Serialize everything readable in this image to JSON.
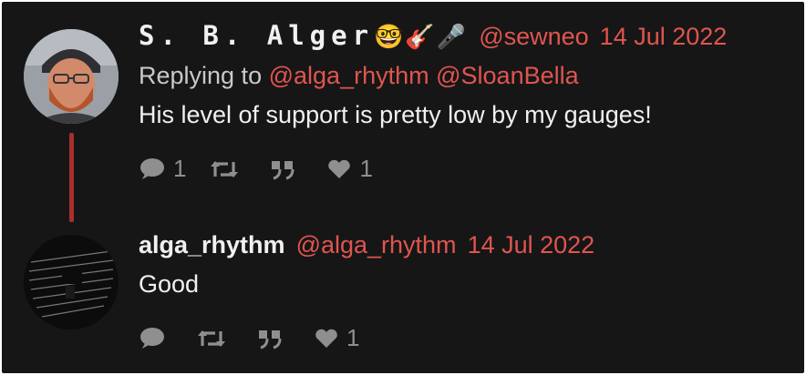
{
  "thread": [
    {
      "display_name": "S. B. Alger",
      "name_emojis": "🤓🎸🎤",
      "handle": "@sewneo",
      "date": "14 Jul 2022",
      "replying_label": "Replying to",
      "replying_to": [
        "@alga_rhythm",
        "@SloanBella"
      ],
      "text": "His level of support is pretty low by my gauges!",
      "actions": {
        "replies": "1",
        "retweets": "",
        "quotes": "",
        "likes": "1"
      }
    },
    {
      "display_name": "alga_rhythm",
      "handle": "@alga_rhythm",
      "date": "14 Jul 2022",
      "text": "Good",
      "actions": {
        "replies": "",
        "retweets": "",
        "quotes": "",
        "likes": "1"
      }
    }
  ],
  "colors": {
    "background": "#161616",
    "accent": "#e0554f",
    "thread_line": "#a8302c",
    "muted": "#8f8f8f"
  },
  "icons": [
    "reply-icon",
    "retweet-icon",
    "quote-icon",
    "like-icon"
  ]
}
